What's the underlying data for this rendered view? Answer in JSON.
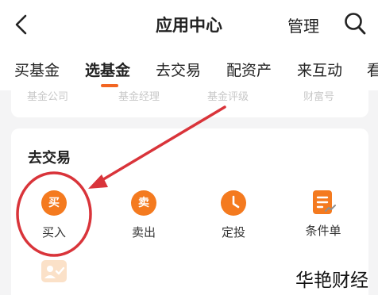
{
  "header": {
    "title": "应用中心",
    "manage_label": "管理"
  },
  "tabs": [
    "买基金",
    "选基金",
    "去交易",
    "配资产",
    "来互动",
    "看"
  ],
  "top_card_labels": [
    "基金公司",
    "基金经理",
    "基金评级",
    "财富号"
  ],
  "trade_section": {
    "title": "去交易",
    "items": [
      {
        "icon_char": "买",
        "label": "买入"
      },
      {
        "icon_char": "卖",
        "label": "卖出"
      },
      {
        "label": "定投"
      },
      {
        "label": "条件单"
      }
    ]
  },
  "watermark": "华艳财经",
  "colors": {
    "accent": "#f47a1f",
    "annotation_red": "#d9343a"
  }
}
